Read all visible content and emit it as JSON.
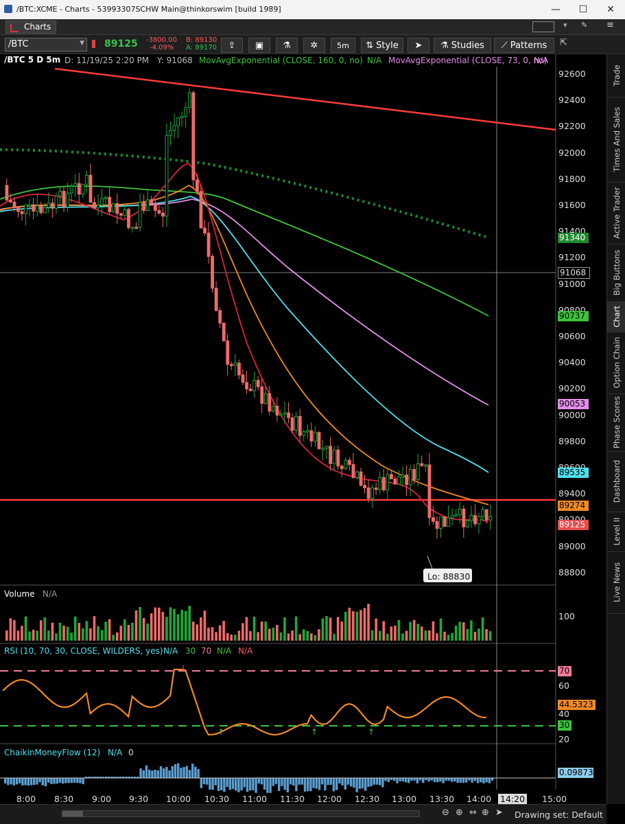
{
  "window": {
    "title": "/BTC:XCME - Charts - 53993307SCHW Main@thinkorswim [build 1989]",
    "minimize": "—",
    "maximize": "☐",
    "close": "✕"
  },
  "tab": {
    "label": "Charts"
  },
  "toolbar": {
    "symbol": "/BTC",
    "last": "89125",
    "change": "-3800.00",
    "change_pct": "-4.09%",
    "bid": "B: 89130",
    "ask": "A: 89170",
    "timeframe": "5m",
    "style": "Style",
    "studies": "Studies",
    "patterns": "Patterns"
  },
  "header": {
    "symbol_period": "/BTC 5 D 5m",
    "date": "D: 11/19/25 2:20 PM",
    "cursor_y": "Y: 91068",
    "study1": "MovAvgExponential (CLOSE, 160, 0, no)",
    "study1_val": "N/A",
    "study2": "MovAvgExponential (CLOSE, 73, 0, no)",
    "study2_val": "N/A"
  },
  "price_axis": [
    "92600",
    "92400",
    "92200",
    "92000",
    "91800",
    "91600",
    "91400",
    "91200",
    "91000",
    "90800",
    "90600",
    "90400",
    "90200",
    "90000",
    "89800",
    "89600",
    "89400",
    "89200",
    "89000",
    "88800"
  ],
  "price_labels": {
    "ema160": "91340",
    "crosshair": "91068",
    "green": "90737",
    "ema73": "90053",
    "cyan": "89535",
    "orange": "89274",
    "last": "89125"
  },
  "low_label": "Lo: 88830",
  "volume": {
    "title": "Volume",
    "value": "N/A",
    "axis": "100"
  },
  "rsi": {
    "title": "RSI (10, 70, 30, CLOSE, WILDERS, yes)",
    "v1": "N/A",
    "ob": "30",
    "os": "70",
    "v2": "N/A",
    "v3": "N/A",
    "axis": [
      "60",
      "40",
      "20"
    ],
    "label_70": "70",
    "label_val": "44.5323",
    "label_30": "30"
  },
  "cmf": {
    "title": "ChaikinMoneyFlow (12)",
    "v1": "N/A",
    "v2": "0",
    "label_val": "0.09873"
  },
  "time_axis": [
    "8:00",
    "8:30",
    "9:00",
    "9:30",
    "10:00",
    "10:30",
    "11:00",
    "11:30",
    "12:00",
    "12:30",
    "13:00",
    "13:30",
    "14:00",
    "14:20",
    "15:00"
  ],
  "status": {
    "drawing_set": "Drawing set: Default"
  },
  "sidebar": [
    "Trade",
    "Times And Sales",
    "Active Trader",
    "Big Buttons",
    "Chart",
    "Option Chain",
    "Phase Scores",
    "Dashboard",
    "Level II",
    "Live News"
  ],
  "colors": {
    "up": "#1fa83a",
    "down": "#f06a6a",
    "ema160": "#1e8a2e",
    "green": "#3cc43c",
    "magenta": "#e38ee8",
    "cyan": "#4fe0ec",
    "orange": "#f08a26",
    "red": "#d8203f",
    "trend": "#ff3b3b"
  }
}
